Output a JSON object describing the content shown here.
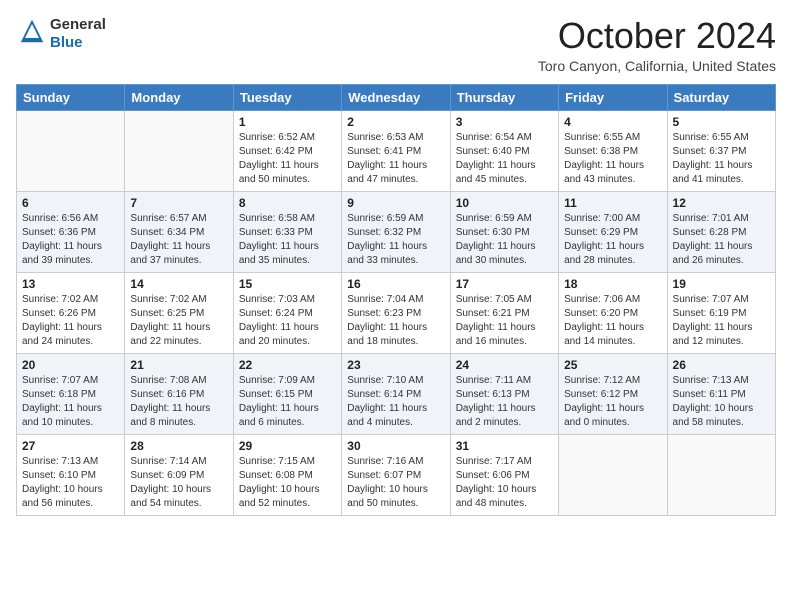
{
  "logo": {
    "line1": "General",
    "line2": "Blue"
  },
  "header": {
    "month": "October 2024",
    "location": "Toro Canyon, California, United States"
  },
  "weekdays": [
    "Sunday",
    "Monday",
    "Tuesday",
    "Wednesday",
    "Thursday",
    "Friday",
    "Saturday"
  ],
  "weeks": [
    [
      {
        "day": "",
        "content": ""
      },
      {
        "day": "",
        "content": ""
      },
      {
        "day": "1",
        "content": "Sunrise: 6:52 AM\nSunset: 6:42 PM\nDaylight: 11 hours and 50 minutes."
      },
      {
        "day": "2",
        "content": "Sunrise: 6:53 AM\nSunset: 6:41 PM\nDaylight: 11 hours and 47 minutes."
      },
      {
        "day": "3",
        "content": "Sunrise: 6:54 AM\nSunset: 6:40 PM\nDaylight: 11 hours and 45 minutes."
      },
      {
        "day": "4",
        "content": "Sunrise: 6:55 AM\nSunset: 6:38 PM\nDaylight: 11 hours and 43 minutes."
      },
      {
        "day": "5",
        "content": "Sunrise: 6:55 AM\nSunset: 6:37 PM\nDaylight: 11 hours and 41 minutes."
      }
    ],
    [
      {
        "day": "6",
        "content": "Sunrise: 6:56 AM\nSunset: 6:36 PM\nDaylight: 11 hours and 39 minutes."
      },
      {
        "day": "7",
        "content": "Sunrise: 6:57 AM\nSunset: 6:34 PM\nDaylight: 11 hours and 37 minutes."
      },
      {
        "day": "8",
        "content": "Sunrise: 6:58 AM\nSunset: 6:33 PM\nDaylight: 11 hours and 35 minutes."
      },
      {
        "day": "9",
        "content": "Sunrise: 6:59 AM\nSunset: 6:32 PM\nDaylight: 11 hours and 33 minutes."
      },
      {
        "day": "10",
        "content": "Sunrise: 6:59 AM\nSunset: 6:30 PM\nDaylight: 11 hours and 30 minutes."
      },
      {
        "day": "11",
        "content": "Sunrise: 7:00 AM\nSunset: 6:29 PM\nDaylight: 11 hours and 28 minutes."
      },
      {
        "day": "12",
        "content": "Sunrise: 7:01 AM\nSunset: 6:28 PM\nDaylight: 11 hours and 26 minutes."
      }
    ],
    [
      {
        "day": "13",
        "content": "Sunrise: 7:02 AM\nSunset: 6:26 PM\nDaylight: 11 hours and 24 minutes."
      },
      {
        "day": "14",
        "content": "Sunrise: 7:02 AM\nSunset: 6:25 PM\nDaylight: 11 hours and 22 minutes."
      },
      {
        "day": "15",
        "content": "Sunrise: 7:03 AM\nSunset: 6:24 PM\nDaylight: 11 hours and 20 minutes."
      },
      {
        "day": "16",
        "content": "Sunrise: 7:04 AM\nSunset: 6:23 PM\nDaylight: 11 hours and 18 minutes."
      },
      {
        "day": "17",
        "content": "Sunrise: 7:05 AM\nSunset: 6:21 PM\nDaylight: 11 hours and 16 minutes."
      },
      {
        "day": "18",
        "content": "Sunrise: 7:06 AM\nSunset: 6:20 PM\nDaylight: 11 hours and 14 minutes."
      },
      {
        "day": "19",
        "content": "Sunrise: 7:07 AM\nSunset: 6:19 PM\nDaylight: 11 hours and 12 minutes."
      }
    ],
    [
      {
        "day": "20",
        "content": "Sunrise: 7:07 AM\nSunset: 6:18 PM\nDaylight: 11 hours and 10 minutes."
      },
      {
        "day": "21",
        "content": "Sunrise: 7:08 AM\nSunset: 6:16 PM\nDaylight: 11 hours and 8 minutes."
      },
      {
        "day": "22",
        "content": "Sunrise: 7:09 AM\nSunset: 6:15 PM\nDaylight: 11 hours and 6 minutes."
      },
      {
        "day": "23",
        "content": "Sunrise: 7:10 AM\nSunset: 6:14 PM\nDaylight: 11 hours and 4 minutes."
      },
      {
        "day": "24",
        "content": "Sunrise: 7:11 AM\nSunset: 6:13 PM\nDaylight: 11 hours and 2 minutes."
      },
      {
        "day": "25",
        "content": "Sunrise: 7:12 AM\nSunset: 6:12 PM\nDaylight: 11 hours and 0 minutes."
      },
      {
        "day": "26",
        "content": "Sunrise: 7:13 AM\nSunset: 6:11 PM\nDaylight: 10 hours and 58 minutes."
      }
    ],
    [
      {
        "day": "27",
        "content": "Sunrise: 7:13 AM\nSunset: 6:10 PM\nDaylight: 10 hours and 56 minutes."
      },
      {
        "day": "28",
        "content": "Sunrise: 7:14 AM\nSunset: 6:09 PM\nDaylight: 10 hours and 54 minutes."
      },
      {
        "day": "29",
        "content": "Sunrise: 7:15 AM\nSunset: 6:08 PM\nDaylight: 10 hours and 52 minutes."
      },
      {
        "day": "30",
        "content": "Sunrise: 7:16 AM\nSunset: 6:07 PM\nDaylight: 10 hours and 50 minutes."
      },
      {
        "day": "31",
        "content": "Sunrise: 7:17 AM\nSunset: 6:06 PM\nDaylight: 10 hours and 48 minutes."
      },
      {
        "day": "",
        "content": ""
      },
      {
        "day": "",
        "content": ""
      }
    ]
  ]
}
